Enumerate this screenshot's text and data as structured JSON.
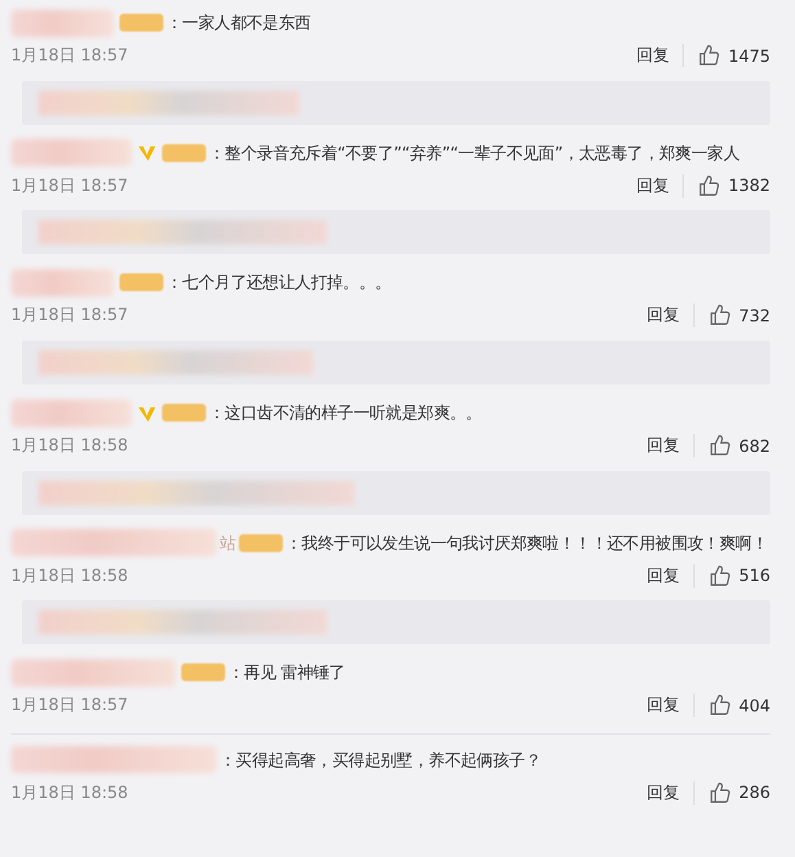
{
  "comments": [
    {
      "vip": false,
      "badge": true,
      "text": "：一家人都不是东西",
      "time": "1月18日 18:57",
      "reply": "回复",
      "likes": "1475",
      "reply_preview": true,
      "divider": false
    },
    {
      "vip": true,
      "badge": true,
      "text": "：整个录音充斥着“不要了”“弃养”“一辈子不见面”，太恶毒了，郑爽一家人",
      "time": "1月18日 18:57",
      "reply": "回复",
      "likes": "1382",
      "reply_preview": true,
      "divider": false
    },
    {
      "vip": false,
      "badge": true,
      "text": "：七个月了还想让人打掉。。。",
      "time": "1月18日 18:57",
      "reply": "回复",
      "likes": "732",
      "reply_preview": true,
      "divider": false
    },
    {
      "vip": true,
      "badge": true,
      "text": "：这口齿不清的样子一听就是郑爽。。",
      "time": "1月18日 18:58",
      "reply": "回复",
      "likes": "682",
      "reply_preview": true,
      "divider": false
    },
    {
      "vip": false,
      "badge": true,
      "name_tail": "站",
      "text": "：我终于可以发生说一句我讨厌郑爽啦！！！还不用被围攻！爽啊！",
      "time": "1月18日 18:58",
      "reply": "回复",
      "likes": "516",
      "reply_preview": true,
      "divider": false
    },
    {
      "vip": false,
      "badge": true,
      "text": "：再见 雷神锤了",
      "time": "1月18日 18:57",
      "reply": "回复",
      "likes": "404",
      "reply_preview": false,
      "divider": true
    },
    {
      "vip": false,
      "badge": false,
      "text": "：买得起高奢，买得起别墅，养不起俩孩子？",
      "time": "1月18日 18:58",
      "reply": "回复",
      "likes": "286",
      "reply_preview": false,
      "divider": false
    }
  ]
}
